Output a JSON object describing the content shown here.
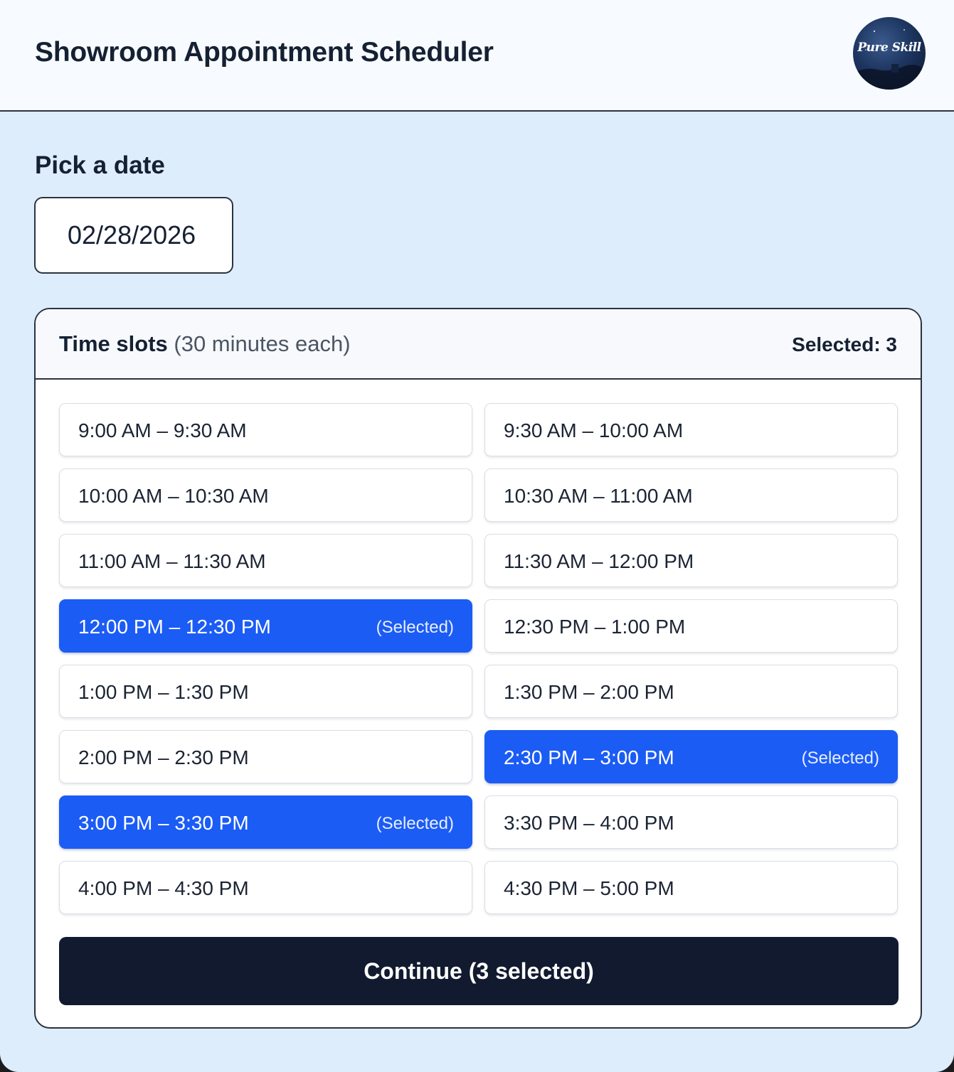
{
  "header": {
    "title": "Showroom Appointment Scheduler",
    "avatar_text": "Pure Skill"
  },
  "date": {
    "label": "Pick a date",
    "value": "02/28/2026"
  },
  "slots_panel": {
    "title": "Time slots",
    "subtitle": "(30 minutes each)",
    "selected_count": "Selected: 3",
    "selected_tag": "(Selected)",
    "slots": [
      {
        "label": "9:00 AM – 9:30 AM",
        "selected": false
      },
      {
        "label": "9:30 AM – 10:00 AM",
        "selected": false
      },
      {
        "label": "10:00 AM – 10:30 AM",
        "selected": false
      },
      {
        "label": "10:30 AM – 11:00 AM",
        "selected": false
      },
      {
        "label": "11:00 AM – 11:30 AM",
        "selected": false
      },
      {
        "label": "11:30 AM – 12:00 PM",
        "selected": false
      },
      {
        "label": "12:00 PM – 12:30 PM",
        "selected": true
      },
      {
        "label": "12:30 PM – 1:00 PM",
        "selected": false
      },
      {
        "label": "1:00 PM – 1:30 PM",
        "selected": false
      },
      {
        "label": "1:30 PM – 2:00 PM",
        "selected": false
      },
      {
        "label": "2:00 PM – 2:30 PM",
        "selected": false
      },
      {
        "label": "2:30 PM – 3:00 PM",
        "selected": true
      },
      {
        "label": "3:00 PM – 3:30 PM",
        "selected": true
      },
      {
        "label": "3:30 PM – 4:00 PM",
        "selected": false
      },
      {
        "label": "4:00 PM – 4:30 PM",
        "selected": false
      },
      {
        "label": "4:30 PM – 5:00 PM",
        "selected": false
      }
    ],
    "continue_label": "Continue (3 selected)"
  },
  "colors": {
    "page_bg": "#deedfc",
    "selected_slot": "#1b5cf5",
    "continue_button": "#111a2e",
    "text_dark": "#152033"
  }
}
